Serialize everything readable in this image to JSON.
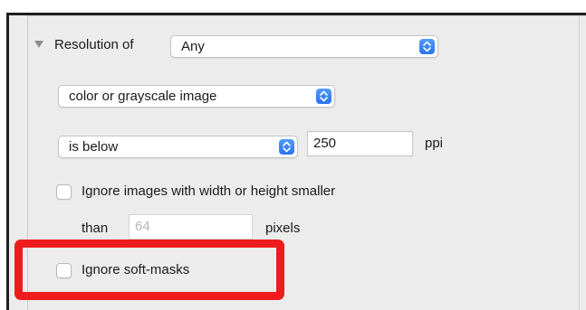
{
  "resolution": {
    "label": "Resolution of",
    "scope_selected": "Any",
    "image_type_selected": "color or grayscale image",
    "comparison_selected": "is below",
    "threshold_value": "250",
    "unit": "ppi"
  },
  "ignore_small": {
    "label": "Ignore images with width or height smaller",
    "than_label": "than",
    "placeholder": "64",
    "unit": "pixels"
  },
  "ignore_soft_masks": {
    "label": "Ignore soft-masks"
  },
  "colors": {
    "highlight": "#ee1c1c",
    "stepper_blue": "#2b72f0"
  }
}
